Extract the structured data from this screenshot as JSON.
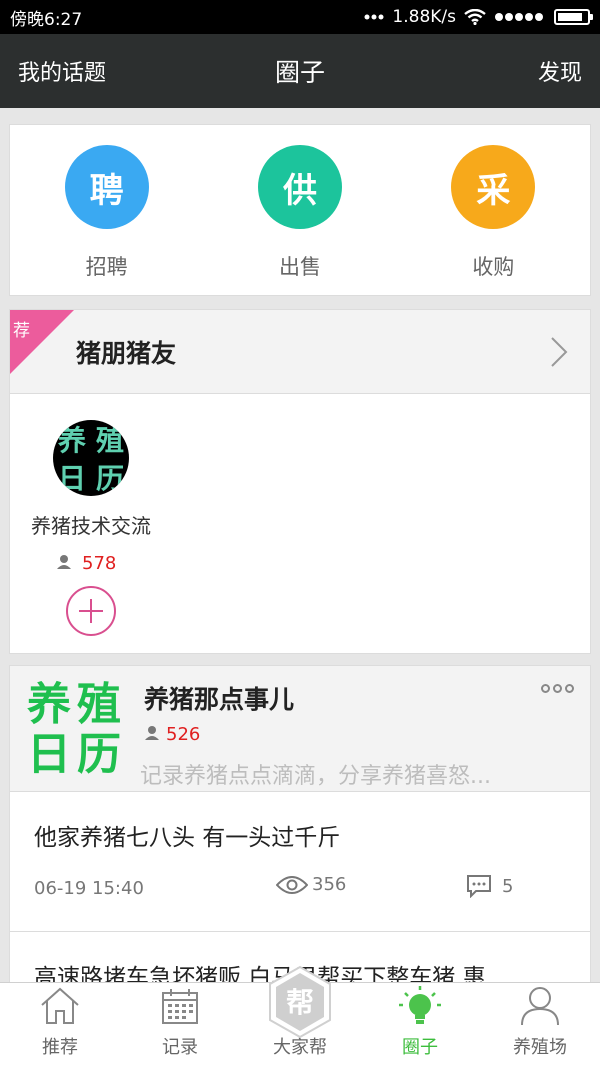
{
  "status_bar": {
    "time": "傍晚6:27",
    "network_speed": "1.88K/s",
    "battery_level": 0.85
  },
  "nav": {
    "left": "我的话题",
    "title": "圈子",
    "right": "发现"
  },
  "quick_actions": [
    {
      "glyph": "聘",
      "label": "招聘",
      "color": "#3aa9f2"
    },
    {
      "glyph": "供",
      "label": "出售",
      "color": "#1cc49c"
    },
    {
      "glyph": "采",
      "label": "收购",
      "color": "#f7a91b"
    }
  ],
  "recommend": {
    "tag": "荐",
    "title": "猪朋猪友",
    "group": {
      "avatar_glyphs": [
        "养",
        "殖",
        "日",
        "历"
      ],
      "name": "养猪技术交流",
      "member_count": "578"
    }
  },
  "feed": {
    "logo_glyphs": [
      "养",
      "殖",
      "日",
      "历"
    ],
    "title": "养猪那点事儿",
    "member_count": "526",
    "description": "记录养猪点点滴滴，分享养猪喜怒...",
    "posts": [
      {
        "title": "他家养猪七八头 有一头过千斤",
        "date": "06-19 15:40",
        "views": "356",
        "comments": "5"
      },
      {
        "title": "高速路堵车急坏猪贩 白马男帮买下整车猪 惠",
        "date": "",
        "views": "",
        "comments": ""
      }
    ]
  },
  "tabs": [
    {
      "label": "推荐",
      "icon": "home-icon"
    },
    {
      "label": "记录",
      "icon": "calendar-icon"
    },
    {
      "label": "大家帮",
      "icon": "help-badge-icon",
      "badge_glyph": "帮"
    },
    {
      "label": "圈子",
      "icon": "lightbulb-icon",
      "active": true
    },
    {
      "label": "养殖场",
      "icon": "person-icon"
    }
  ]
}
